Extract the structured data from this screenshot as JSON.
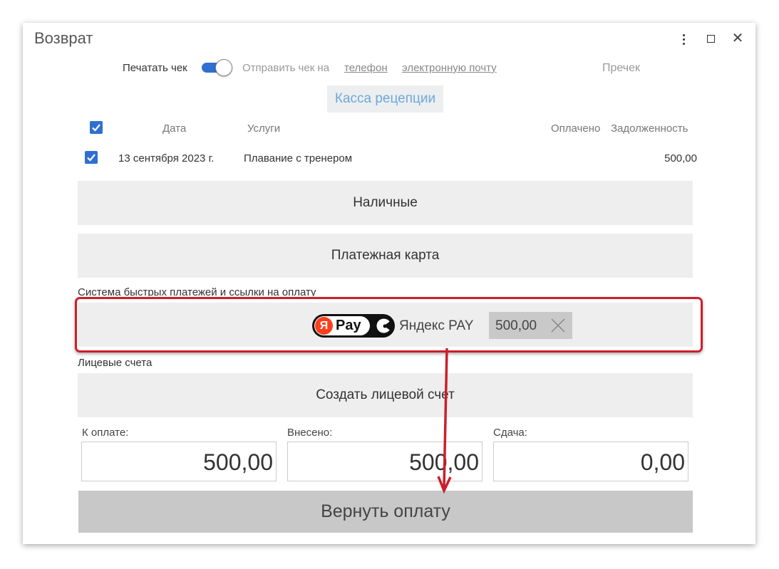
{
  "window": {
    "title": "Возврат"
  },
  "receipt": {
    "print_label": "Печатать чек",
    "print_enabled": true,
    "send_label": "Отправить чек на",
    "phone_link": "телефон",
    "email_link": "электронную почту",
    "precheck_label": "Пречек"
  },
  "register": {
    "label": "Касса рецепции"
  },
  "table": {
    "headers": {
      "date": "Дата",
      "services": "Услуги",
      "paid": "Оплачено",
      "debt": "Задолженность"
    },
    "rows": [
      {
        "checked": true,
        "date": "13 сентября 2023 г.",
        "service": "Плавание с тренером",
        "paid": "",
        "debt": "500,00"
      }
    ]
  },
  "payment_methods": {
    "cash_label": "Наличные",
    "card_label": "Платежная карта",
    "sbp_section_label": "Система быстрых платежей и ссылки на оплату",
    "yandex": {
      "logo_text": "Pay",
      "logo_letter": "Я",
      "name": "Яндекс PAY",
      "amount": "500,00"
    }
  },
  "accounts": {
    "section_label": "Лицевые счета",
    "create_label": "Создать лицевой счет"
  },
  "totals": {
    "due_label": "К оплате:",
    "due_value": "500,00",
    "paid_label": "Внесено:",
    "paid_value": "500,00",
    "change_label": "Сдача:",
    "change_value": "0,00"
  },
  "actions": {
    "refund_label": "Вернуть оплату"
  },
  "colors": {
    "accent": "#2f6fd0",
    "highlight": "#cc1f2a",
    "yandex_red": "#fc3f1d"
  }
}
